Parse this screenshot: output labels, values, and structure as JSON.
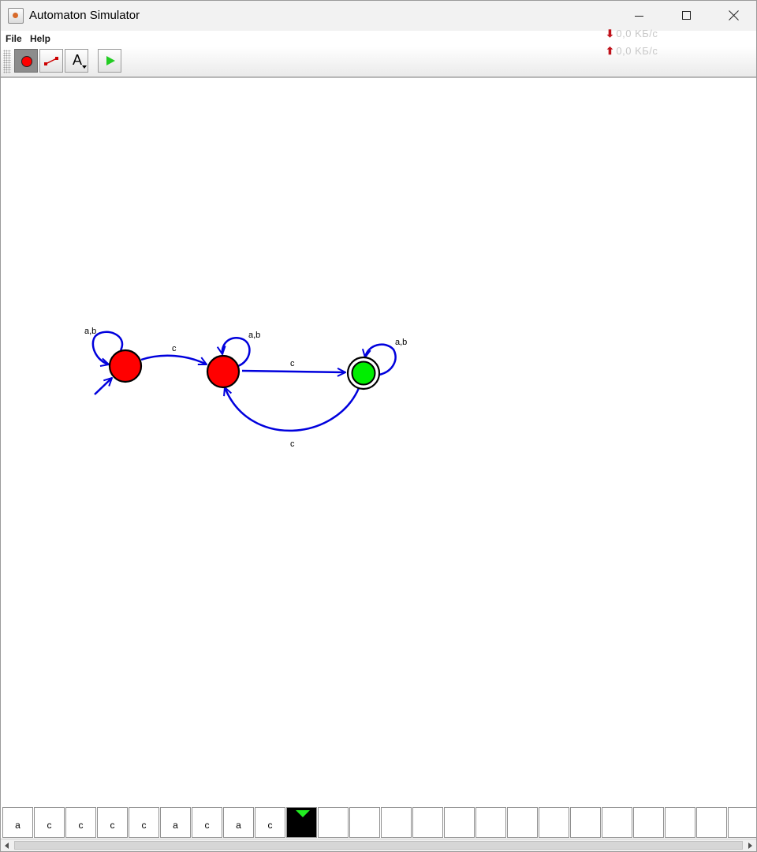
{
  "window": {
    "title": "Automaton Simulator"
  },
  "menu": {
    "file": "File",
    "help": "Help"
  },
  "network": {
    "download": "0,0 KБ/с",
    "upload": "0,0 KБ/с"
  },
  "toolbar": {
    "tools": [
      {
        "name": "state-tool",
        "icon": "red-circle-icon",
        "active": true
      },
      {
        "name": "transition-tool",
        "icon": "line-icon",
        "active": false
      },
      {
        "name": "text-tool",
        "icon": "text-A-icon",
        "active": false
      },
      {
        "name": "run-tool",
        "icon": "play-icon",
        "active": false
      }
    ],
    "text_tool_glyph": "A"
  },
  "automaton": {
    "states": [
      {
        "id": "q0",
        "initial": true,
        "accepting": false,
        "color": "#ff0000"
      },
      {
        "id": "q1",
        "initial": false,
        "accepting": false,
        "color": "#ff0000"
      },
      {
        "id": "q2",
        "initial": false,
        "accepting": true,
        "color": "#00ee00"
      }
    ],
    "transitions": [
      {
        "from": "q0",
        "to": "q0",
        "label": "a,b"
      },
      {
        "from": "q0",
        "to": "q1",
        "label": "c"
      },
      {
        "from": "q1",
        "to": "q1",
        "label": "a,b"
      },
      {
        "from": "q1",
        "to": "q2",
        "label": "c"
      },
      {
        "from": "q2",
        "to": "q2",
        "label": "a,b"
      },
      {
        "from": "q2",
        "to": "q1",
        "label": "c"
      }
    ],
    "edge_color": "#0000dd"
  },
  "tape": {
    "cells": [
      "a",
      "c",
      "c",
      "c",
      "c",
      "a",
      "c",
      "a",
      "c",
      "",
      "",
      "",
      "",
      "",
      "",
      "",
      "",
      "",
      "",
      "",
      "",
      "",
      "",
      ""
    ],
    "head_index": 9
  }
}
